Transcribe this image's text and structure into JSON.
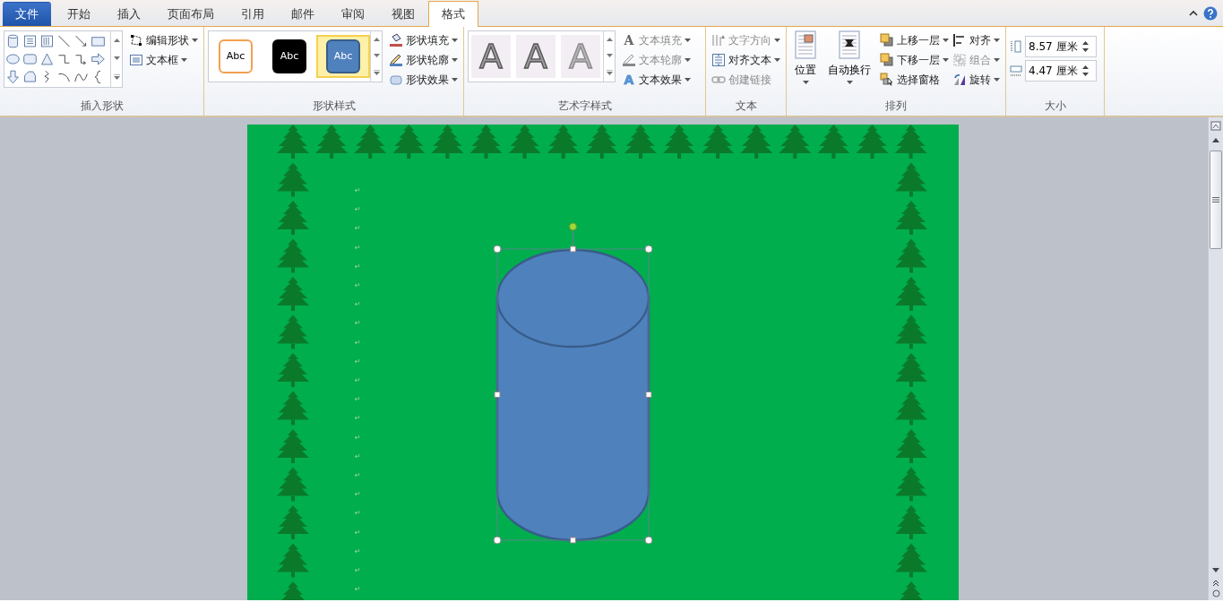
{
  "tabs": [
    {
      "label": "文件",
      "kind": "file",
      "selected": false
    },
    {
      "label": "开始",
      "kind": "normal",
      "selected": false
    },
    {
      "label": "插入",
      "kind": "normal",
      "selected": false
    },
    {
      "label": "页面布局",
      "kind": "normal",
      "selected": false
    },
    {
      "label": "引用",
      "kind": "normal",
      "selected": false
    },
    {
      "label": "邮件",
      "kind": "normal",
      "selected": false
    },
    {
      "label": "审阅",
      "kind": "normal",
      "selected": false
    },
    {
      "label": "视图",
      "kind": "normal",
      "selected": false
    },
    {
      "label": "格式",
      "kind": "normal",
      "selected": true
    }
  ],
  "insert_shapes": {
    "label": "插入形状",
    "commands": [
      {
        "label": "编辑形状"
      },
      {
        "label": "文本框"
      }
    ]
  },
  "shape_styles": {
    "label": "形状样式",
    "presets": [
      {
        "label": "Abc",
        "kind": "outline",
        "selected": false
      },
      {
        "label": "Abc",
        "kind": "dark",
        "selected": false
      },
      {
        "label": "Abc",
        "kind": "blue",
        "selected": true
      }
    ],
    "commands": [
      {
        "label": "形状填充"
      },
      {
        "label": "形状轮廓"
      },
      {
        "label": "形状效果"
      }
    ]
  },
  "wordart_styles": {
    "label": "艺术字样式",
    "presets": [
      {
        "label": "A"
      },
      {
        "label": "A"
      },
      {
        "label": "A"
      }
    ],
    "commands": [
      {
        "glyph": "A",
        "label": "文本填充",
        "disabled": true
      },
      {
        "label": "文本轮廓",
        "disabled": true
      },
      {
        "glyph": "A",
        "label": "文本效果",
        "disabled": false
      }
    ]
  },
  "text_group": {
    "label": "文本",
    "commands": [
      {
        "label": "文字方向",
        "disabled": true
      },
      {
        "label": "对齐文本",
        "disabled": false
      },
      {
        "label": "创建链接",
        "disabled": true
      }
    ]
  },
  "arrange": {
    "label": "排列",
    "large_commands": [
      {
        "label": "位置"
      },
      {
        "label": "自动换行"
      }
    ],
    "commands": [
      {
        "label": "上移一层",
        "disabled": false,
        "dropdown": true
      },
      {
        "label": "对齐",
        "disabled": false,
        "dropdown": true
      },
      {
        "label": "下移一层",
        "disabled": false,
        "dropdown": true
      },
      {
        "label": "组合",
        "disabled": true,
        "dropdown": true
      },
      {
        "label": "选择窗格",
        "disabled": false,
        "dropdown": false
      },
      {
        "label": "旋转",
        "disabled": false,
        "dropdown": true
      }
    ]
  },
  "size": {
    "label": "大小",
    "fields": [
      {
        "value": "8.57 厘米",
        "kind": "height"
      },
      {
        "value": "4.47 厘米",
        "kind": "width"
      }
    ]
  },
  "document": {
    "paragraph_marks": [
      "↵",
      "↵",
      "↵",
      "↵",
      "↵",
      "↵",
      "↵",
      "↵",
      "↵",
      "↵",
      "↵",
      "↵",
      "↵",
      "↵",
      "↵",
      "↵",
      "↵",
      "↵",
      "↵",
      "↵",
      "↵",
      "↵"
    ],
    "shape": {
      "kind": "cylinder",
      "selected": true
    }
  }
}
